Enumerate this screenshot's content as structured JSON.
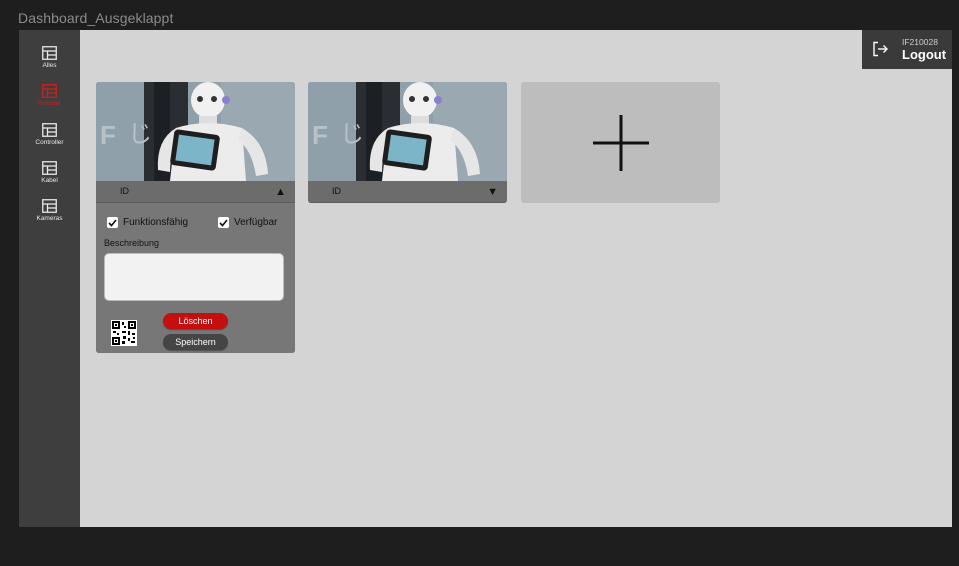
{
  "window": {
    "title": "Dashboard_Ausgeklappt"
  },
  "sidebar": {
    "items": [
      {
        "label": "Alles",
        "icon": "grid-table-icon",
        "active": false
      },
      {
        "label": "Roboter",
        "icon": "grid-table-icon",
        "active": true
      },
      {
        "label": "Controller",
        "icon": "grid-table-icon",
        "active": false
      },
      {
        "label": "Kabel",
        "icon": "grid-table-icon",
        "active": false
      },
      {
        "label": "Kameras",
        "icon": "grid-table-icon",
        "active": false
      }
    ]
  },
  "user": {
    "id": "IF210028",
    "logout_label": "Logout",
    "icon": "logout-icon"
  },
  "cards": [
    {
      "id_label": "ID",
      "expanded": true,
      "arrow": "▲",
      "image": "robot-photo",
      "checkboxes": [
        {
          "label": "Funktionsfähig",
          "checked": true
        },
        {
          "label": "Verfügbar",
          "checked": true
        }
      ],
      "description_label": "Beschreibung",
      "description_value": "",
      "delete_label": "Löschen",
      "save_label": "Speichern"
    },
    {
      "id_label": "ID",
      "expanded": false,
      "arrow": "▼",
      "image": "robot-photo"
    }
  ],
  "add_card": {
    "icon": "plus-icon"
  },
  "colors": {
    "accent_red": "#c50f0f",
    "sidebar_bg": "#3e3e3e",
    "content_bg": "#d4d4d4"
  }
}
